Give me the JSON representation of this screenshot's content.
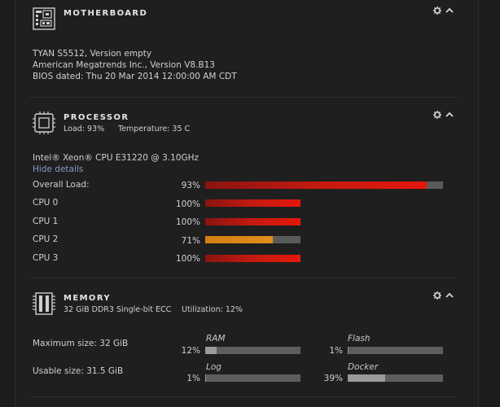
{
  "motherboard": {
    "title": "MOTHERBOARD",
    "lines": [
      "TYAN S5512, Version empty",
      "American Megatrends Inc., Version V8.B13",
      "BIOS dated: Thu 20 Mar 2014 12:00:00 AM CDT"
    ]
  },
  "processor": {
    "title": "PROCESSOR",
    "load": "Load: 93%",
    "temperature": "Temperature: 35 C",
    "cpu_name": "Intel® Xeon® CPU E31220 @ 3.10GHz",
    "hide_details": "Hide details",
    "rows": [
      {
        "label": "Overall Load:",
        "pct_text": "93%",
        "value": 93,
        "color": "red"
      },
      {
        "label": "CPU 0",
        "pct_text": "100%",
        "value": 100,
        "color": "red"
      },
      {
        "label": "CPU 1",
        "pct_text": "100%",
        "value": 100,
        "color": "red"
      },
      {
        "label": "CPU 2",
        "pct_text": "71%",
        "value": 71,
        "color": "orange"
      },
      {
        "label": "CPU 3",
        "pct_text": "100%",
        "value": 100,
        "color": "red"
      }
    ]
  },
  "memory": {
    "title": "MEMORY",
    "summary": "32 GiB DDR3 Single-bit ECC",
    "utilization": "Utilization: 12%",
    "max_size": "Maximum size: 32 GiB",
    "usable_size": "Usable size: 31.5 GiB",
    "gauges": [
      {
        "label": "RAM",
        "pct_text": "12%",
        "value": 12
      },
      {
        "label": "Flash",
        "pct_text": "1%",
        "value": 1
      },
      {
        "label": "Log",
        "pct_text": "1%",
        "value": 1
      },
      {
        "label": "Docker",
        "pct_text": "39%",
        "value": 39
      }
    ]
  },
  "controls": {
    "settings_icon": "gear-icon",
    "collapse_icon": "chevron-up-icon"
  },
  "colors": {
    "red_bar": "#e4180c",
    "orange_bar": "#e08e1c",
    "gray_fill": "#9a9a9a",
    "track": "#5a5a5a"
  }
}
